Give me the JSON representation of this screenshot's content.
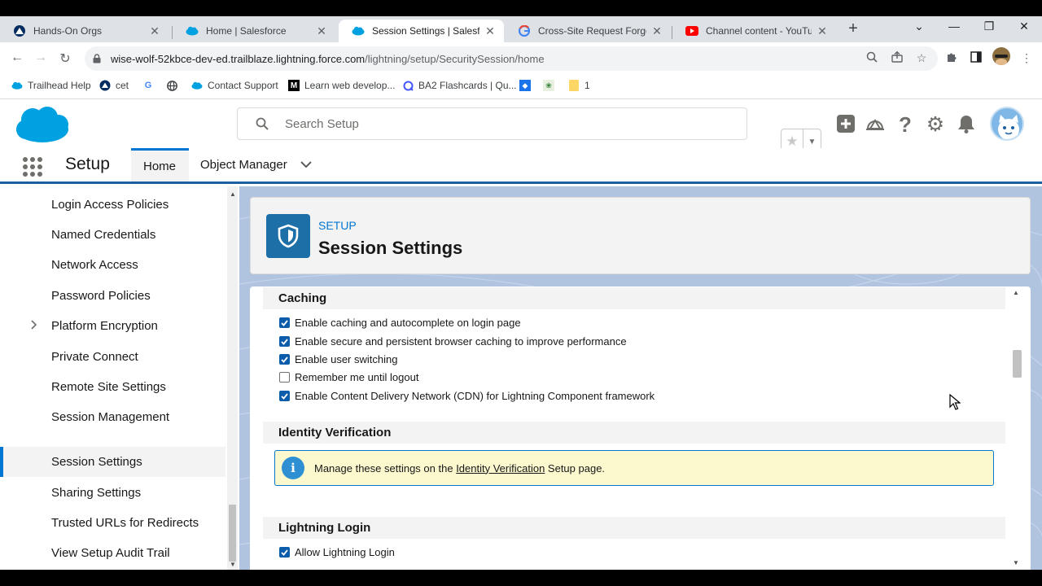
{
  "browser": {
    "tabs": [
      {
        "title": "Hands-On Orgs",
        "close": "✕"
      },
      {
        "title": "Home | Salesforce",
        "close": "✕"
      },
      {
        "title": "Session Settings | Salesforce",
        "close": "✕"
      },
      {
        "title": "Cross-Site Request Forgery (",
        "close": "✕"
      },
      {
        "title": "Channel content - YouTube S",
        "close": "✕"
      }
    ],
    "new_tab": "+",
    "url_host": "wise-wolf-52kbce-dev-ed.trailblaze.lightning.force.com",
    "url_path": "/lightning/setup/SecuritySession/home",
    "bookmarks": [
      {
        "label": "Trailhead Help"
      },
      {
        "label": "cet"
      },
      {
        "label": ""
      },
      {
        "label": ""
      },
      {
        "label": "Contact Support"
      },
      {
        "label": "Learn web develop..."
      },
      {
        "label": "BA2 Flashcards | Qu..."
      },
      {
        "label": ""
      },
      {
        "label": ""
      },
      {
        "label": "1"
      }
    ]
  },
  "header": {
    "search_placeholder": "Search Setup"
  },
  "nav": {
    "app_name": "Setup",
    "tabs": [
      {
        "label": "Home"
      },
      {
        "label": "Object Manager"
      }
    ]
  },
  "sidebar": {
    "items": [
      {
        "label": "Login Access Policies"
      },
      {
        "label": "Named Credentials"
      },
      {
        "label": "Network Access"
      },
      {
        "label": "Password Policies"
      },
      {
        "label": "Platform Encryption"
      },
      {
        "label": "Private Connect"
      },
      {
        "label": "Remote Site Settings"
      },
      {
        "label": "Session Management"
      },
      {
        "label": "Session Settings"
      },
      {
        "label": "Sharing Settings"
      },
      {
        "label": "Trusted URLs for Redirects"
      },
      {
        "label": "View Setup Audit Trail"
      }
    ]
  },
  "page": {
    "eyebrow": "SETUP",
    "title": "Session Settings"
  },
  "caching": {
    "heading": "Caching",
    "options": [
      {
        "label": "Enable caching and autocomplete on login page",
        "checked": true
      },
      {
        "label": "Enable secure and persistent browser caching to improve performance",
        "checked": true
      },
      {
        "label": "Enable user switching",
        "checked": true
      },
      {
        "label": "Remember me until logout",
        "checked": false
      },
      {
        "label": "Enable Content Delivery Network (CDN) for Lightning Component framework",
        "checked": true
      }
    ]
  },
  "identity": {
    "heading": "Identity Verification",
    "info_prefix": "Manage these settings on the ",
    "info_link": "Identity Verification",
    "info_suffix": " Setup page."
  },
  "lightning_login": {
    "heading": "Lightning Login",
    "options": [
      {
        "label": "Allow Lightning Login",
        "checked": true
      }
    ]
  },
  "colors": {
    "brand_blue": "#0176d3",
    "setup_badge": "#1d6fa8",
    "salesforce_cloud": "#00a1e0",
    "info_bg": "#fcf9cf"
  }
}
